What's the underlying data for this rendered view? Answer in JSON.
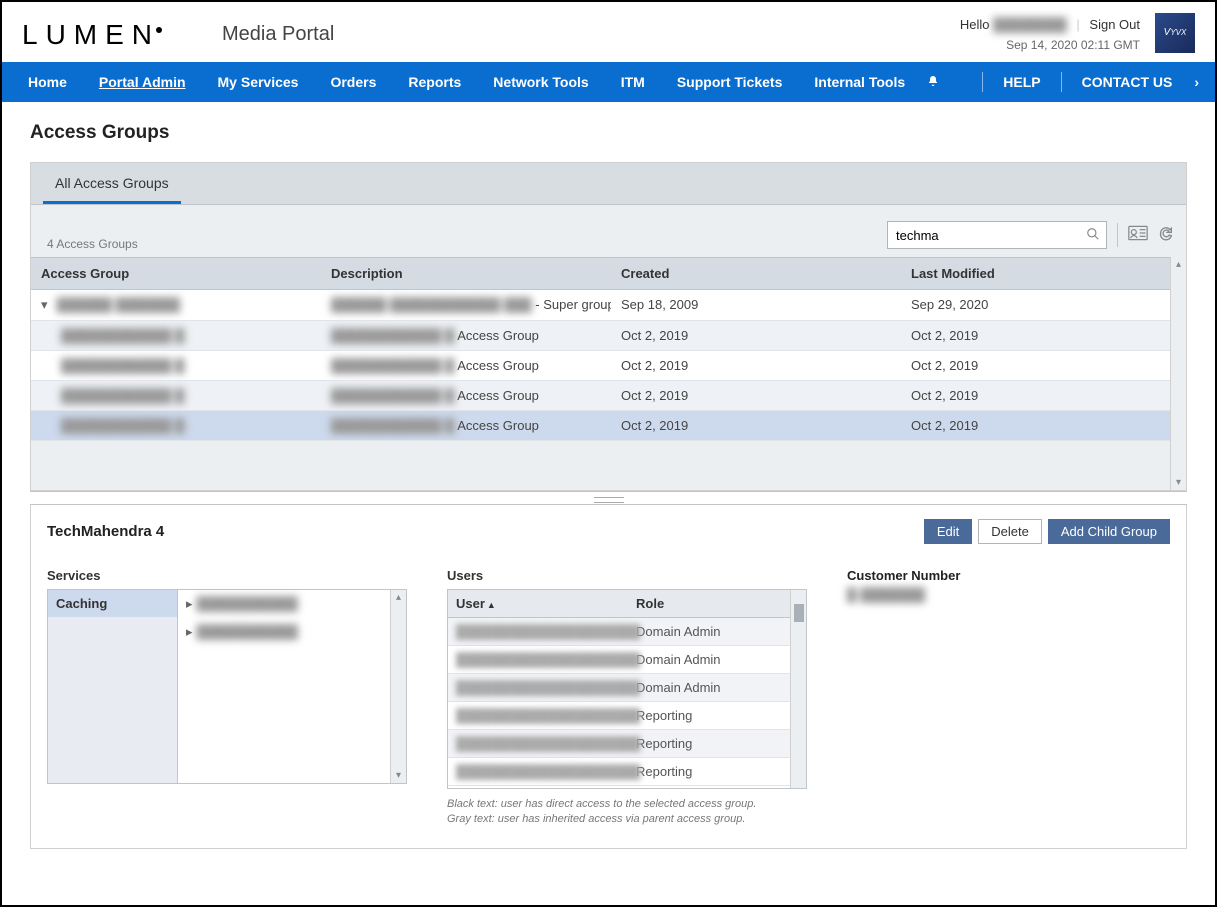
{
  "header": {
    "logo_text": "LUMEN",
    "app_title": "Media Portal",
    "greeting_prefix": "Hello",
    "greeting_user": "████████",
    "signout": "Sign Out",
    "timestamp": "Sep 14, 2020 02:11 GMT",
    "brand_box": "Vyvx"
  },
  "nav": {
    "items": [
      "Home",
      "Portal Admin",
      "My Services",
      "Orders",
      "Reports",
      "Network Tools",
      "ITM",
      "Support Tickets",
      "Internal Tools"
    ],
    "active_index": 1,
    "help": "HELP",
    "contact": "CONTACT US"
  },
  "page": {
    "title": "Access Groups",
    "tab_label": "All Access Groups",
    "count_text": "4 Access Groups",
    "search_value": "techma",
    "columns": [
      "Access Group",
      "Description",
      "Created",
      "Last Modified"
    ],
    "rows": [
      {
        "name": "██████ ███████",
        "desc_prefix": "██████ ████████████ ███",
        "desc_suffix": " - Super group",
        "created": "Sep 18, 2009",
        "modified": "Sep 29, 2020",
        "indent": false,
        "caret": true
      },
      {
        "name": "████████████ █",
        "desc_prefix": "████████████ █",
        "desc_suffix": " Access Group",
        "created": "Oct 2, 2019",
        "modified": "Oct 2, 2019",
        "indent": true,
        "caret": false
      },
      {
        "name": "████████████ █",
        "desc_prefix": "████████████ █",
        "desc_suffix": " Access Group",
        "created": "Oct 2, 2019",
        "modified": "Oct 2, 2019",
        "indent": true,
        "caret": false
      },
      {
        "name": "████████████ █",
        "desc_prefix": "████████████ █",
        "desc_suffix": " Access Group",
        "created": "Oct 2, 2019",
        "modified": "Oct 2, 2019",
        "indent": true,
        "caret": false
      },
      {
        "name": "████████████ █",
        "desc_prefix": "████████████ █",
        "desc_suffix": " Access Group",
        "created": "Oct 2, 2019",
        "modified": "Oct 2, 2019",
        "indent": true,
        "caret": false
      }
    ],
    "selected_row_index": 4
  },
  "detail": {
    "selected_name": "TechMahendra 4",
    "buttons": {
      "edit": "Edit",
      "delete": "Delete",
      "add_child": "Add Child Group"
    },
    "services": {
      "title": "Services",
      "side_item": "Caching",
      "tree": [
        "███████████",
        "███████████"
      ]
    },
    "users": {
      "title": "Users",
      "columns": [
        "User",
        "Role"
      ],
      "rows": [
        {
          "user": "████████████████████",
          "role": "Domain Admin"
        },
        {
          "user": "████████████████████",
          "role": "Domain Admin"
        },
        {
          "user": "████████████████████",
          "role": "Domain Admin"
        },
        {
          "user": "████████████████████",
          "role": "Reporting"
        },
        {
          "user": "████████████████████",
          "role": "Reporting"
        },
        {
          "user": "████████████████████",
          "role": "Reporting"
        }
      ],
      "legend1": "Black text: user has direct access to the selected access group.",
      "legend2": "Gray text: user has inherited access via parent access group."
    },
    "customer": {
      "title": "Customer Number",
      "value": "█-███████"
    }
  }
}
